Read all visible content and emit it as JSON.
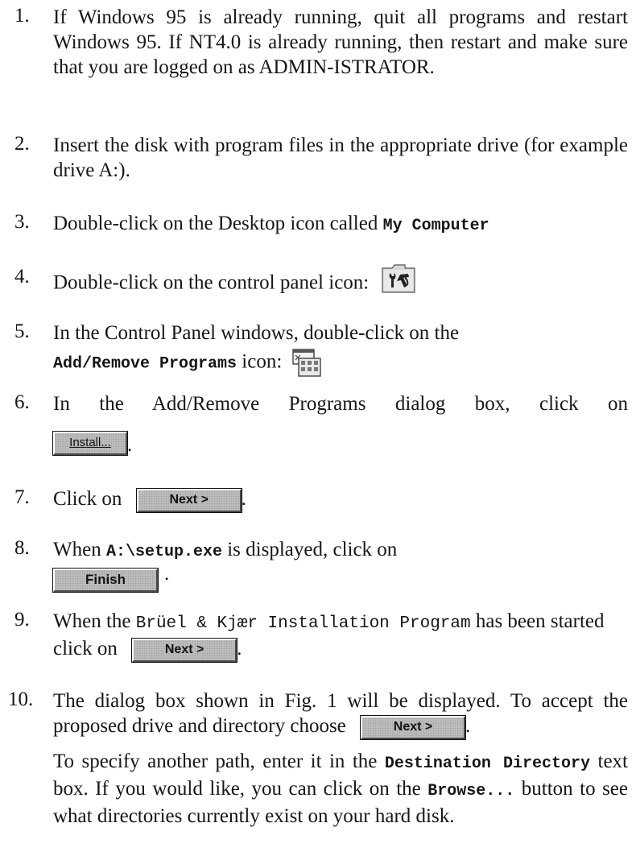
{
  "steps": [
    {
      "num": "1.",
      "text": "If Windows 95 is already running, quit all programs and restart Windows 95. If NT4.0 is already running, then restart and make sure that you are logged on as ADMIN-ISTRATOR."
    },
    {
      "num": "2.",
      "text": "Insert the disk with program files in the appropriate drive (for example drive A:)."
    },
    {
      "num": "3.",
      "text": "Double-click on the Desktop icon called ",
      "code": "My Computer"
    },
    {
      "num": "4.",
      "text": "Double-click on the control panel icon:",
      "icon": "control-panel-icon"
    },
    {
      "num": "5.",
      "line1": "In the Control Panel windows, double-click on the",
      "code": "Add/Remove Programs",
      "text2": " icon:",
      "icon": "add-remove-programs-icon"
    },
    {
      "num": "6.",
      "text": "In the Add/Remove Programs dialog box, click on",
      "button": "Install...",
      "after": "."
    },
    {
      "num": "7.",
      "text": "Click on",
      "button": "Next >",
      "after": "."
    },
    {
      "num": "8.",
      "text_pre": "When ",
      "code": "A:\\setup.exe",
      "text_post": " is displayed, click on",
      "button": "Finish",
      "after": "."
    },
    {
      "num": "9.",
      "text_pre": "When the ",
      "code": "Brüel & Kjær Installation Program",
      "text_post": " has been started click on",
      "button": "Next >",
      "after": "."
    },
    {
      "num": "10.",
      "text": "The dialog box shown in Fig. 1 will be displayed. To accept the proposed drive and directory choose",
      "button": "Next >",
      "after": ".",
      "para2_a": "To specify another path, enter it in the ",
      "para2_code1": "Destination Directory",
      "para2_b": " text box. If you would like, you can click on the ",
      "para2_code2": "Browse...",
      "para2_c": " button to see what directories currently exist on your hard disk."
    }
  ],
  "icons": {
    "accent": "#c4c4c4"
  }
}
